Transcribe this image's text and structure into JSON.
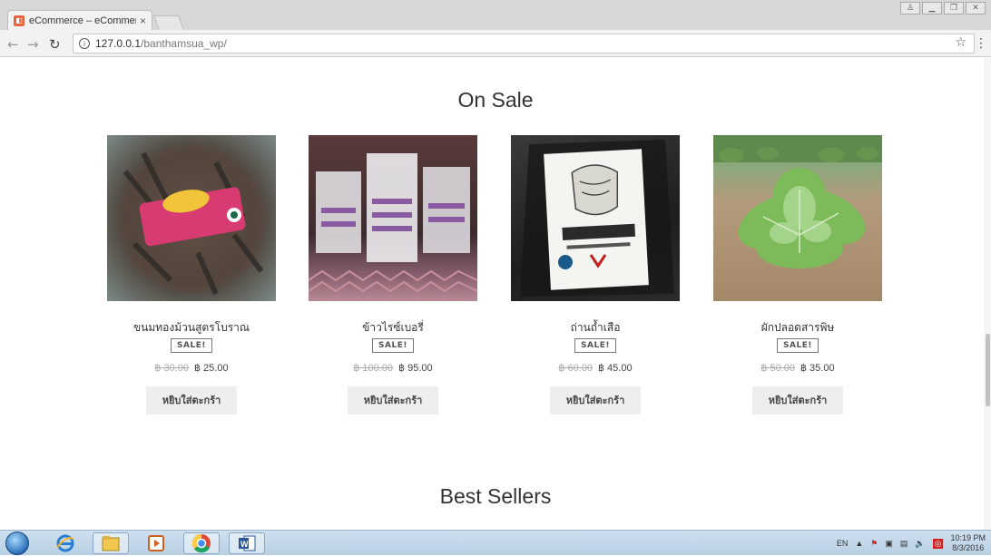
{
  "browser": {
    "tab_title": "eCommerce – eCommerce",
    "tab_close": "×",
    "url_host": "127.0.0.1",
    "url_path": "/banthamsua_wp/",
    "info_glyph": "i",
    "back_icon": "arrow-left-icon",
    "forward_icon": "arrow-right-icon",
    "reload_icon": "reload-icon",
    "star_glyph": "☆",
    "menu_glyph": "⋮",
    "window_controls": [
      "minimize",
      "maximize",
      "close"
    ]
  },
  "sections": {
    "on_sale_title": "On Sale",
    "best_sellers_title": "Best Sellers"
  },
  "products": [
    {
      "name": "ขนมทองม้วนสูตรโบราณ",
      "badge": "SALE!",
      "old_price": "฿ 30.00",
      "new_price": "฿ 25.00",
      "button": "หยิบใส่ตะกร้า"
    },
    {
      "name": "ข้าวไรซ์เบอรี่",
      "badge": "SALE!",
      "old_price": "฿ 100.00",
      "new_price": "฿ 95.00",
      "button": "หยิบใส่ตะกร้า"
    },
    {
      "name": "ถ่านถ้ำเสือ",
      "badge": "SALE!",
      "old_price": "฿ 60.00",
      "new_price": "฿ 45.00",
      "button": "หยิบใส่ตะกร้า"
    },
    {
      "name": "ผักปลอดสารพิษ",
      "badge": "SALE!",
      "old_price": "฿ 50.00",
      "new_price": "฿ 35.00",
      "button": "หยิบใส่ตะกร้า"
    }
  ],
  "taskbar": {
    "lang": "EN",
    "time": "10:19 PM",
    "date": "8/3/2016"
  },
  "colors": {
    "accent_taskbar": "#b8cfe4",
    "button_bg": "#eeeeee",
    "text": "#333333"
  }
}
